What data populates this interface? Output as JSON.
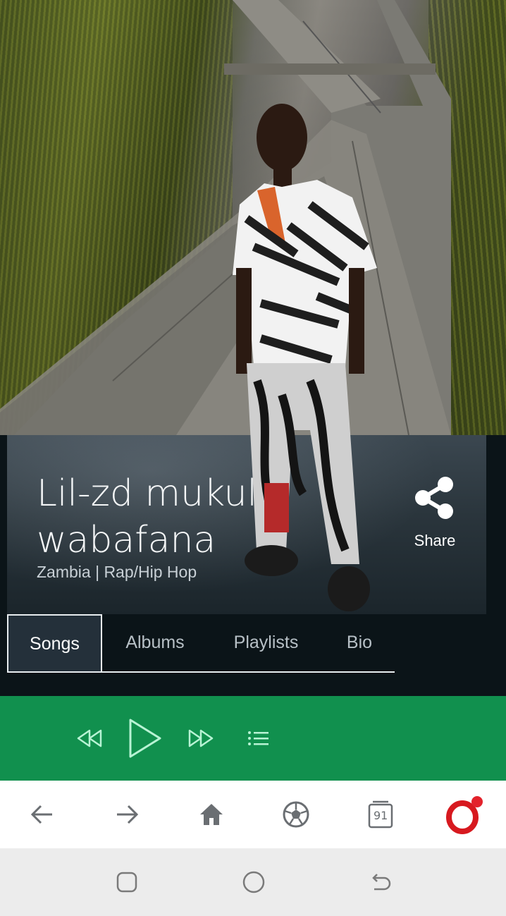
{
  "artist": {
    "name": "Lil-zd mukulu wabafana",
    "meta": "Zambia | Rap/Hip Hop"
  },
  "share": {
    "label": "Share",
    "icon": "share-icon"
  },
  "tabs": [
    {
      "label": "Songs",
      "active": true
    },
    {
      "label": "Albums",
      "active": false
    },
    {
      "label": "Playlists",
      "active": false
    },
    {
      "label": "Bio",
      "active": false
    }
  ],
  "player": {
    "color": "#11904e",
    "buttons": [
      "rewind-icon",
      "play-icon",
      "fast-forward-icon",
      "queue-list-icon"
    ]
  },
  "browser_toolbar": {
    "tab_count": "91",
    "buttons": [
      "back-arrow-icon",
      "forward-arrow-icon",
      "home-icon",
      "soccer-ball-icon",
      "tabs-icon",
      "opera-icon"
    ]
  },
  "system_nav": {
    "buttons": [
      "recent-apps-icon",
      "home-circle-icon",
      "back-icon"
    ]
  }
}
